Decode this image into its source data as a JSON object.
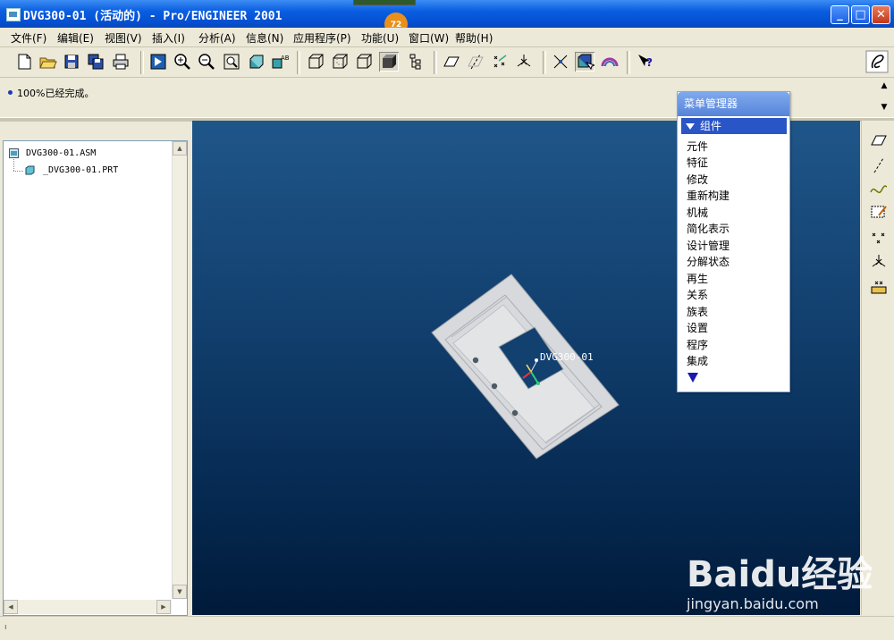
{
  "window": {
    "title": "DVG300-01 (活动的) - Pro/ENGINEER 2001",
    "progress_badge": "72"
  },
  "menubar": {
    "items": [
      "文件(F)",
      "编辑(E)",
      "视图(V)",
      "插入(I)",
      "分析(A)",
      "信息(N)",
      "应用程序(P)",
      "功能(U)",
      "窗口(W)",
      "帮助(H)"
    ]
  },
  "toolbar": {
    "icons": [
      "new-icon",
      "open-icon",
      "save-icon",
      "save-copy-icon",
      "print-icon",
      "repaint-icon",
      "zoom-in-icon",
      "zoom-out-icon",
      "zoom-fit-icon",
      "orient-icon",
      "saved-views-icon",
      "wireframe-icon",
      "hidden-line-icon",
      "no-hidden-icon",
      "shading-icon",
      "model-tree-icon",
      "datum-planes-icon",
      "datum-axes-icon",
      "datum-points-icon",
      "coordinate-systems-icon",
      "spin-center-icon",
      "selection-filter-icon",
      "appearance-icon",
      "context-help-icon"
    ]
  },
  "message": {
    "text": "100%已经完成。"
  },
  "model_tree": {
    "items": [
      {
        "label": "DVG300-01.ASM",
        "type": "assembly"
      },
      {
        "label": "_DVG300-01.PRT",
        "type": "part"
      }
    ]
  },
  "graphics": {
    "model_label": "DVG300-01"
  },
  "menu_manager": {
    "title": "菜单管理器",
    "section": "组件",
    "items": [
      "元件",
      "特征",
      "修改",
      "重新构建",
      "机械",
      "简化表示",
      "设计管理",
      "分解状态",
      "再生",
      "关系",
      "族表",
      "设置",
      "程序",
      "集成"
    ]
  },
  "watermark": {
    "logo": "Baidu经验",
    "url": "jingyan.baidu.com"
  },
  "colors": {
    "titlebar": "#0a5ee0",
    "graphics_top": "#1f5689",
    "graphics_bottom": "#001a3a",
    "menu_section": "#2a55c7"
  }
}
